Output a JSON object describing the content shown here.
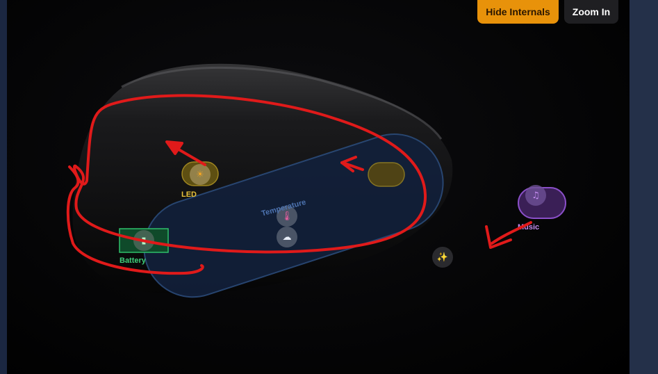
{
  "toolbar": {
    "hide_internals_label": "Hide Internals",
    "zoom_in_label": "Zoom In"
  },
  "components": {
    "led": {
      "label": "LED",
      "icon": "sun-icon",
      "color": "#e8c23a"
    },
    "temperature": {
      "label": "Temperature",
      "icon": "thermometer-icon"
    },
    "battery": {
      "label": "Battery",
      "icon": "battery-icon",
      "color": "#3ecf7a"
    },
    "music": {
      "label": "Music",
      "icon": "music-note-icon",
      "color": "#c58cf0"
    },
    "cloud": {
      "icon": "cloud-icon"
    },
    "sparkle": {
      "icon": "sparkle-icon"
    }
  },
  "colors": {
    "accent_button": "#e8920a",
    "annotation_red": "#e01a1a",
    "board_fill": "#12203a",
    "board_stroke": "#2a4a78"
  }
}
